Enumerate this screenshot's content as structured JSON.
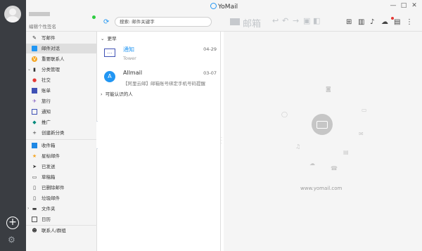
{
  "app": {
    "title": "YoMail",
    "window_controls": [
      "—",
      "□",
      "✕"
    ]
  },
  "profile": {
    "signature": "编辑个性签名"
  },
  "toolbar": {
    "search_placeholder": "搜索: 邮件关键字",
    "mail_label": "邮箱"
  },
  "sidebar": {
    "compose": "写邮件",
    "conversations": "邮件对话",
    "important_contacts": "重要联系人",
    "category_manage": "分类管理",
    "categories": [
      "社交",
      "账单",
      "旅行",
      "通知",
      "推广"
    ],
    "new_category": "创建新分类",
    "folders": [
      "收件箱",
      "星标邮件",
      "已发送",
      "草稿箱",
      "已删除邮件",
      "垃圾邮件"
    ],
    "folder_group": "文件夹",
    "calendar": "日历",
    "contacts": "联系人/群组"
  },
  "messages": {
    "group_recent": "更早",
    "group_unknown": "可能认识的人",
    "items": [
      {
        "from": "通知",
        "sub": "Tower",
        "date": "04-29"
      },
      {
        "from": "Allmail",
        "avatar_letter": "A",
        "sub": "【阿里云邮】邮箱账号绑定手机号码提醒",
        "date": "03-07"
      }
    ]
  },
  "preview": {
    "url": "www.yomail.com"
  },
  "colors": {
    "accent": "#2196f3",
    "rail": "#3a3d42"
  }
}
